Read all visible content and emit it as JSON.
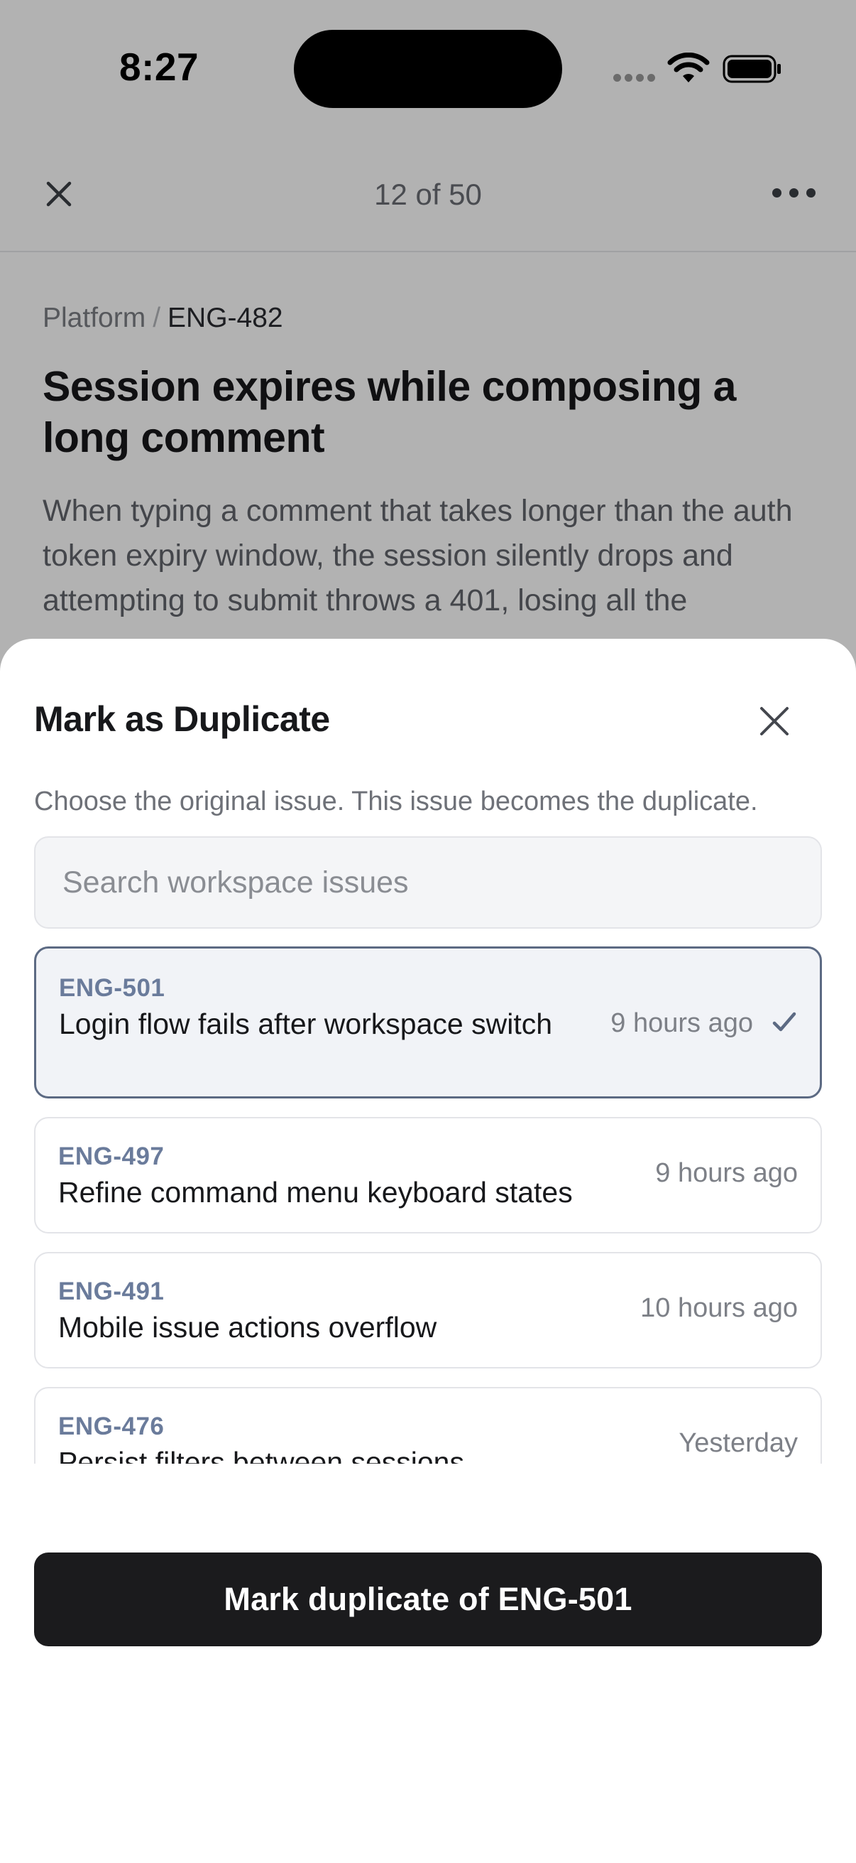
{
  "status_bar": {
    "time": "8:27"
  },
  "nav": {
    "counter": "12 of 50"
  },
  "issue": {
    "team": "Platform",
    "separator": "/",
    "id": "ENG-482",
    "title": "Session expires while composing a long comment",
    "description": "When typing a comment that takes longer than the auth token expiry window, the session silently drops and attempting to submit throws a 401, losing all the"
  },
  "sheet": {
    "title": "Mark as Duplicate",
    "subtitle": "Choose the original issue. This issue becomes the duplicate.",
    "search": {
      "placeholder": "Search workspace issues",
      "value": ""
    },
    "issues": [
      {
        "id": "ENG-501",
        "title": "Login flow fails after workspace switch",
        "time": "9 hours ago",
        "selected": true
      },
      {
        "id": "ENG-497",
        "title": "Refine command menu keyboard states",
        "time": "9 hours ago",
        "selected": false
      },
      {
        "id": "ENG-491",
        "title": "Mobile issue actions overflow",
        "time": "10 hours ago",
        "selected": false
      },
      {
        "id": "ENG-476",
        "title": "Persist filters between sessions",
        "time": "Yesterday",
        "selected": false
      }
    ],
    "primary_button": "Mark duplicate of ENG-501"
  },
  "icons": {
    "close": "close-icon",
    "more": "more-horizontal-icon",
    "check": "checkmark-icon",
    "wifi": "wifi-icon",
    "battery": "battery-icon",
    "signal": "signal-icon"
  },
  "colors": {
    "accent": "#5c6a83",
    "issue_id": "#6a7b9b",
    "primary_button": "#1b1b1d",
    "selected_row_bg": "#f1f3f7"
  }
}
